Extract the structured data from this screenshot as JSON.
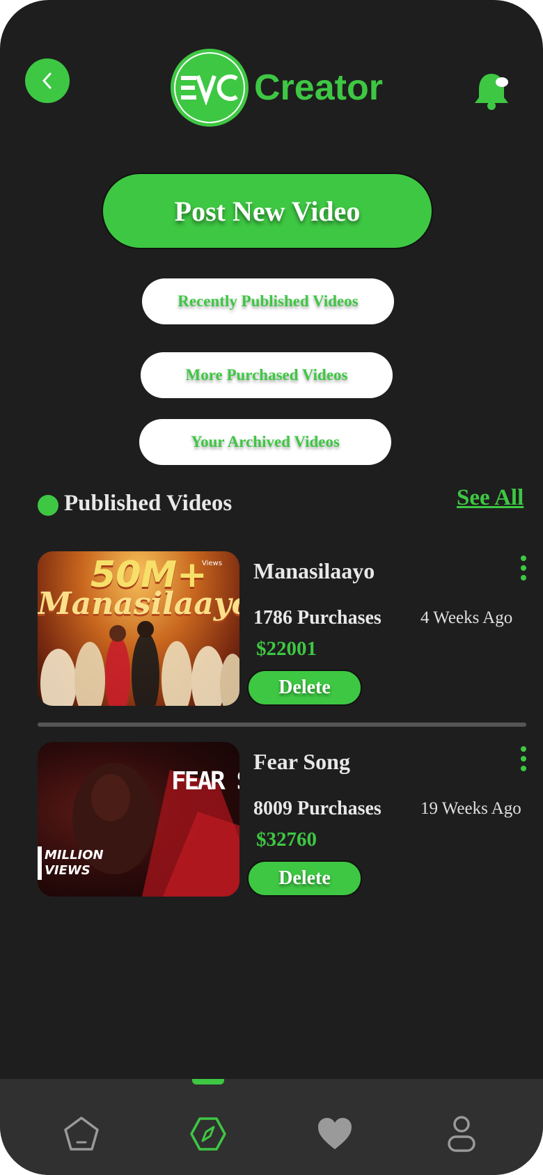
{
  "header": {
    "logo_text": "Creator",
    "logo_mark": "EVC"
  },
  "actions": {
    "post_new_video": "Post New Video",
    "recently_published": "Recently Published Videos",
    "more_purchased": "More Purchased Videos",
    "archived": "Your Archived Videos"
  },
  "section": {
    "title": "Published Videos",
    "see_all": "See All"
  },
  "videos": [
    {
      "title": "Manasilaayo",
      "purchases": "1786 Purchases",
      "ago": "4 Weeks Ago",
      "price": "$22001",
      "delete_label": "Delete",
      "thumb_headline": "50M+",
      "thumb_sub": "Views",
      "thumb_title": "Manasilaayo"
    },
    {
      "title": "Fear Song",
      "purchases": "8009 Purchases",
      "ago": "19 Weeks Ago",
      "price": "$32760",
      "delete_label": "Delete",
      "thumb_headline": "FEAR SO",
      "thumb_badge_line1": "MILLION",
      "thumb_badge_line2": "VIEWS"
    }
  ],
  "icons": {
    "back": "chevron-left-icon",
    "bell": "bell-icon",
    "more": "more-vertical-icon",
    "nav_home": "home-icon",
    "nav_explore": "compass-icon",
    "nav_favorites": "heart-icon",
    "nav_profile": "user-icon"
  },
  "colors": {
    "accent": "#3ec743",
    "background": "#1e1e1e",
    "nav_background": "#303030"
  }
}
